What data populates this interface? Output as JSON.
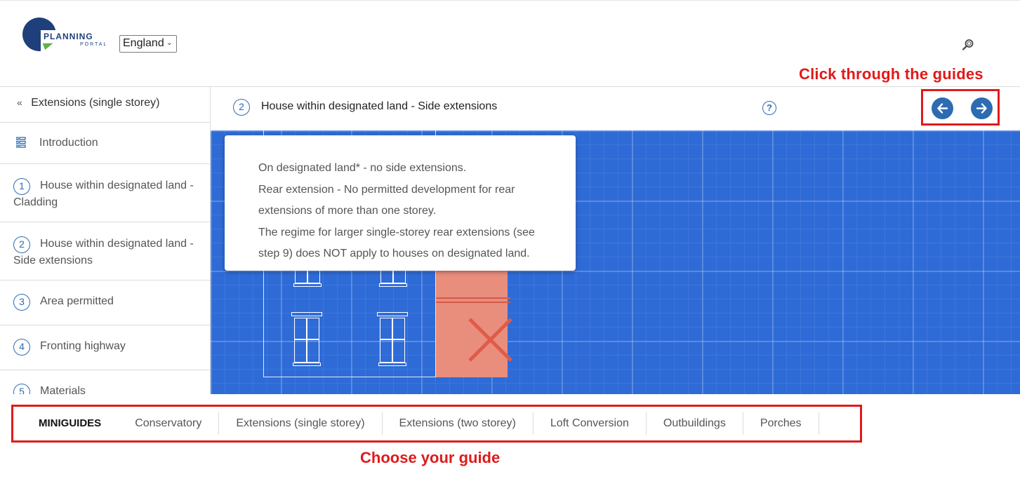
{
  "header": {
    "logo_text_main": "PLANNING",
    "logo_text_sub": "PORTAL",
    "region": "England",
    "search_icon": "search-icon"
  },
  "annotations": {
    "top": "Click through the guides",
    "bottom": "Choose your guide",
    "color": "#e01a1a"
  },
  "sidebar": {
    "back_label": "Extensions (single storey)",
    "intro_label": "Introduction",
    "items": [
      {
        "num": "1",
        "label": "House within designated land - Cladding"
      },
      {
        "num": "2",
        "label": "House within designated land - Side extensions"
      },
      {
        "num": "3",
        "label": "Area permitted"
      },
      {
        "num": "4",
        "label": "Fronting highway"
      },
      {
        "num": "5",
        "label": "Materials"
      }
    ]
  },
  "step": {
    "num": "2",
    "title": "House within designated land - Side extensions",
    "help": "?"
  },
  "tooltip": {
    "lines": [
      "On designated land* - no side extensions.",
      "Rear extension - No permitted development for rear extensions of more than one storey.",
      "The regime for larger single-storey rear extensions (see step 9) does NOT apply to houses on designated land."
    ]
  },
  "guides": {
    "label": "MINIGUIDES",
    "tabs": [
      "Conservatory",
      "Extensions (single storey)",
      "Extensions (two storey)",
      "Loft Conversion",
      "Outbuildings",
      "Porches"
    ]
  },
  "colors": {
    "accent": "#2d6cb2",
    "canvas": "#2f6bd6",
    "extension": "#e98d7d"
  }
}
